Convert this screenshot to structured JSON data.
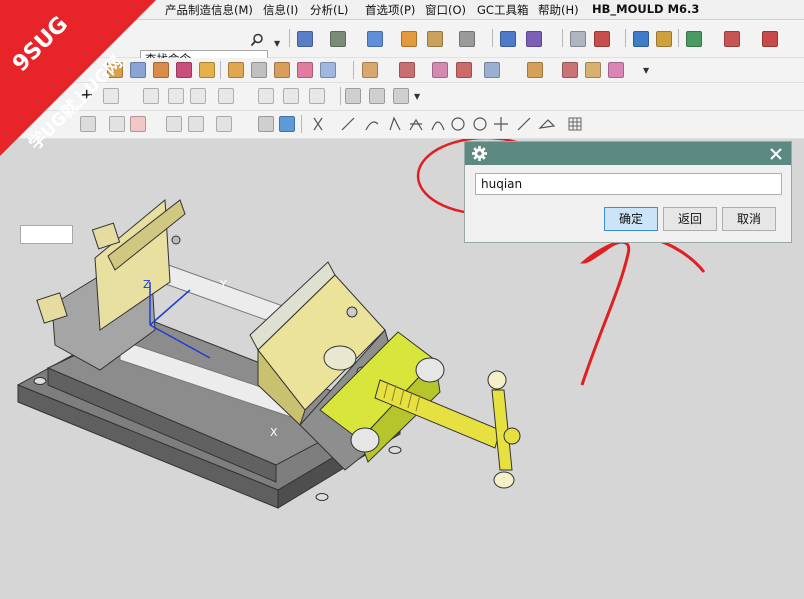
{
  "menubar": {
    "items": [
      {
        "label": "产品制造信息(M)"
      },
      {
        "label": "信息(I)"
      },
      {
        "label": "分析(L)"
      },
      {
        "label": "首选项(P)"
      },
      {
        "label": "窗口(O)"
      },
      {
        "label": "GC工具箱"
      },
      {
        "label": "帮助(H)"
      },
      {
        "label": "HB_MOULD M6.3"
      }
    ]
  },
  "toolbar": {
    "search_placeholder": "查找命令",
    "icons": [
      "search-icon",
      "layer-icon",
      "shading-icon",
      "cube-icon",
      "folder-icon",
      "palette-icon",
      "block-icon",
      "point-icon",
      "line-icon",
      "circle-icon",
      "plus-icon",
      "grid-icon"
    ]
  },
  "dialog": {
    "input_value": "huqian",
    "ok_label": "确定",
    "back_label": "返回",
    "cancel_label": "取消",
    "title_icon": "gear-icon",
    "close_icon": "close-icon"
  },
  "watermark": {
    "line1": "9SUG",
    "line2": "学UG就上UG网",
    "color": "#e8242b"
  },
  "viewport": {
    "axis_labels": {
      "z": "Z",
      "y": "Y",
      "x": "X"
    },
    "background": "#d6d6d6"
  },
  "annotation": {
    "color": "#e02020"
  }
}
